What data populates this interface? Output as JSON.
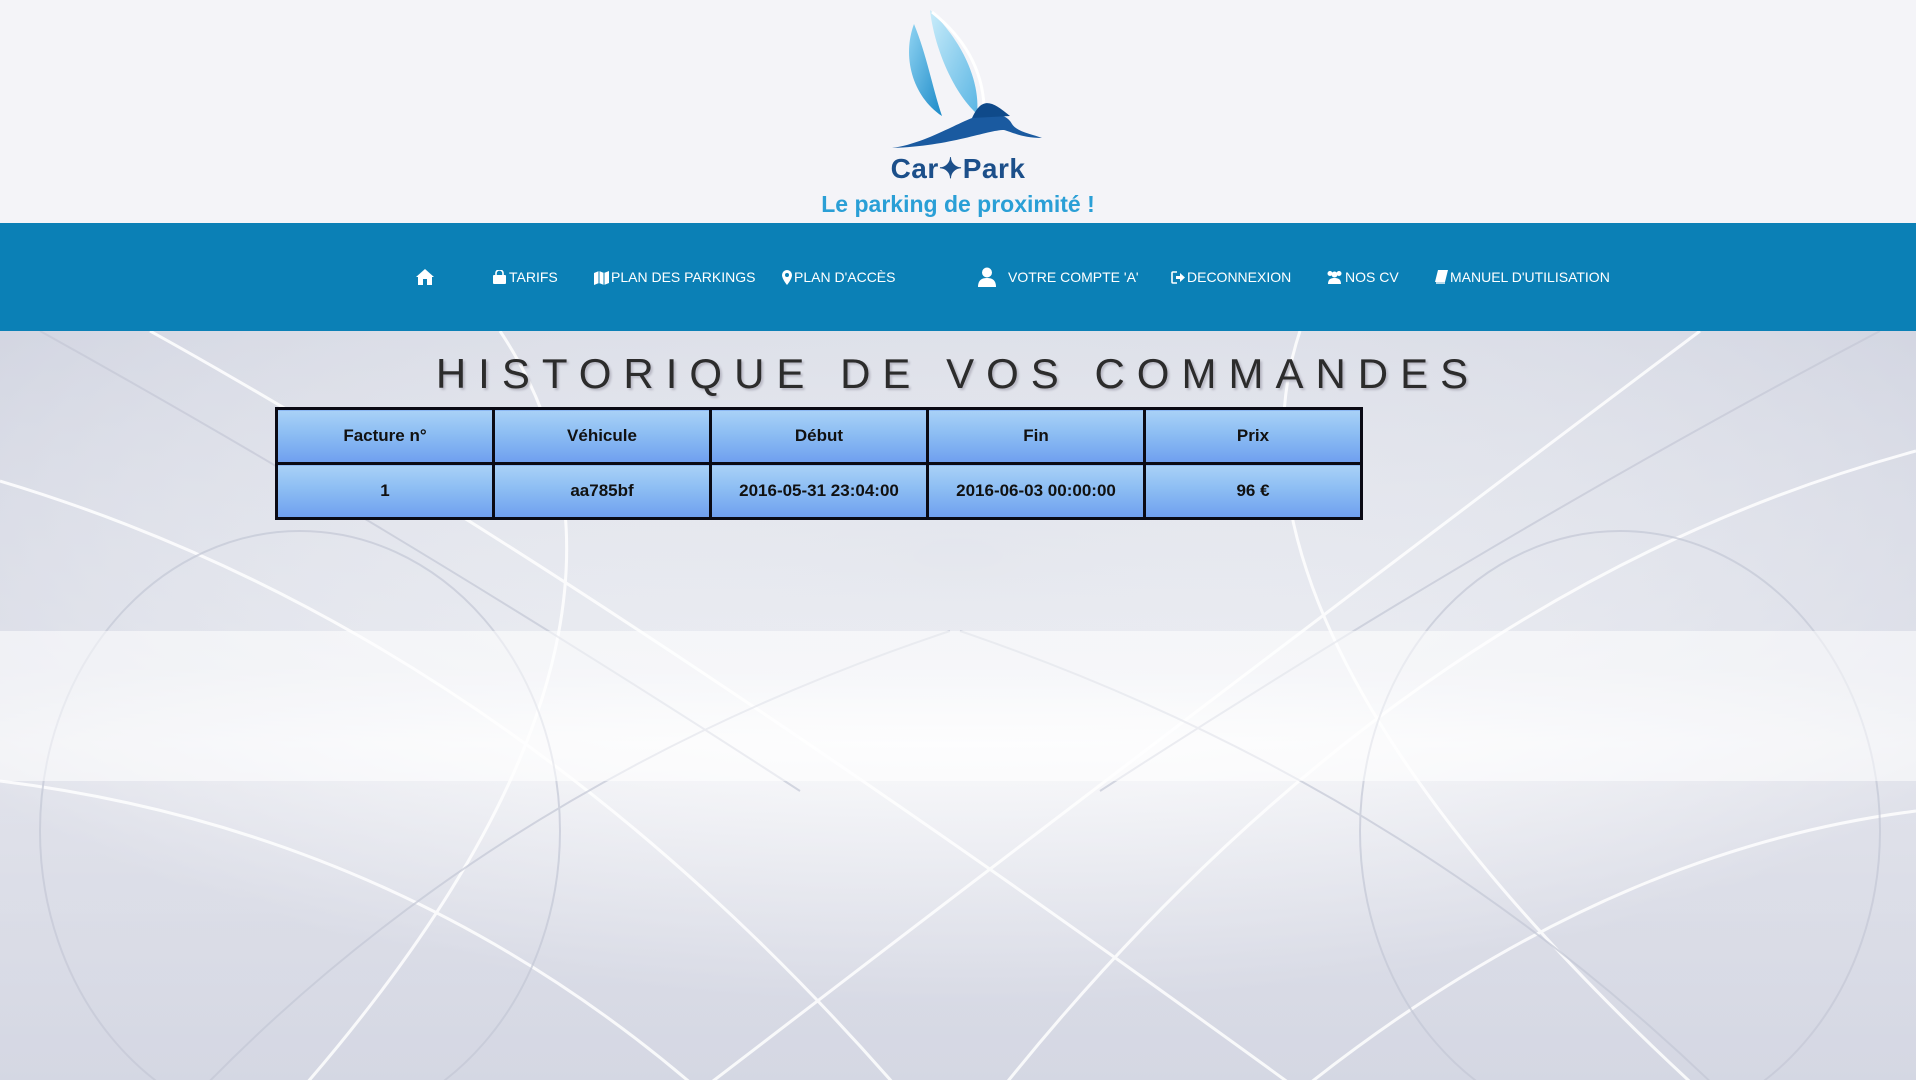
{
  "brand": {
    "name": "Car✦Park",
    "tagline": "Le parking de proximité !"
  },
  "nav": {
    "home_icon": "home-icon",
    "items": [
      {
        "label": "TARIFS",
        "icon": "shopping-bag-icon"
      },
      {
        "label": "PLAN DES PARKINGS",
        "icon": "map-icon"
      },
      {
        "label": "PLAN D'ACCÈS",
        "icon": "map-marker-icon"
      },
      {
        "label": "VOTRE COMPTE 'A'",
        "icon": "user-icon"
      },
      {
        "label": "DECONNEXION",
        "icon": "sign-out-icon"
      },
      {
        "label": "NOS CV",
        "icon": "users-icon"
      },
      {
        "label": "MANUEL D'UTILISATION",
        "icon": "book-icon"
      }
    ]
  },
  "main": {
    "title": "HISTORIQUE DE VOS COMMANDES",
    "table": {
      "headers": [
        "Facture n°",
        "Véhicule",
        "Début",
        "Fin",
        "Prix"
      ],
      "rows": [
        [
          "1",
          "aa785bf",
          "2016-05-31 23:04:00",
          "2016-06-03 00:00:00",
          "96 €"
        ]
      ]
    }
  },
  "colors": {
    "navbar": "#0b80b6",
    "brand": "#1c4f8a",
    "tagline": "#2a9fd6",
    "table_cell": "#8cbdf3"
  }
}
